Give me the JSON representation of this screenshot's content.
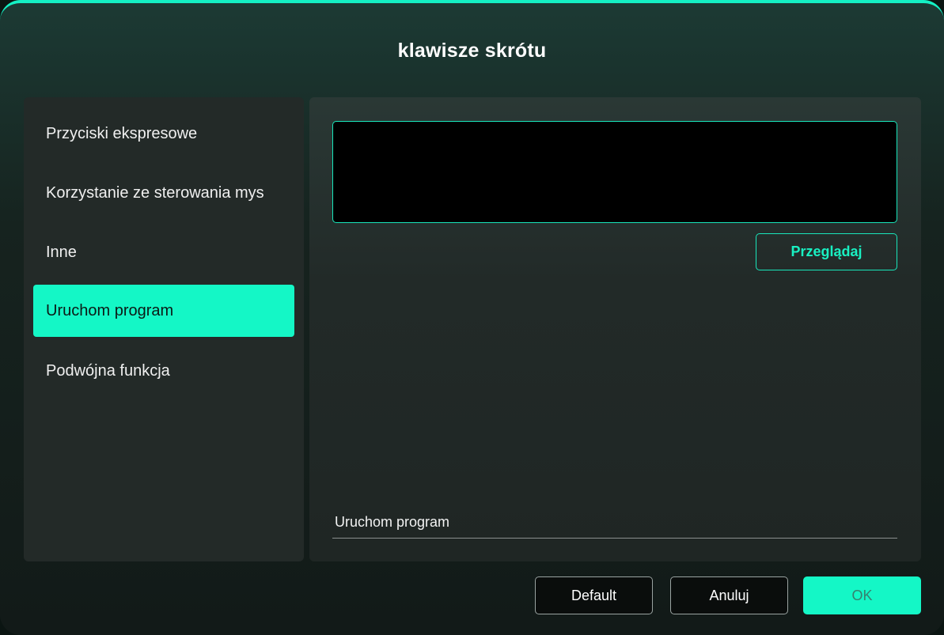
{
  "dialog": {
    "title": "klawisze skrótu"
  },
  "sidebar": {
    "items": [
      {
        "label": "Przyciski ekspresowe"
      },
      {
        "label": "Korzystanie ze sterowania mys"
      },
      {
        "label": "Inne"
      },
      {
        "label": "Uruchom program",
        "active": true
      },
      {
        "label": "Podwójna funkcja"
      }
    ]
  },
  "main": {
    "path_value": "",
    "browse_label": "Przeglądaj",
    "bottom_label": "Uruchom program"
  },
  "footer": {
    "default_label": "Default",
    "cancel_label": "Anuluj",
    "ok_label": "OK"
  },
  "colors": {
    "accent": "#14f7c6",
    "panel": "#232a28",
    "input_bg": "#000000"
  }
}
